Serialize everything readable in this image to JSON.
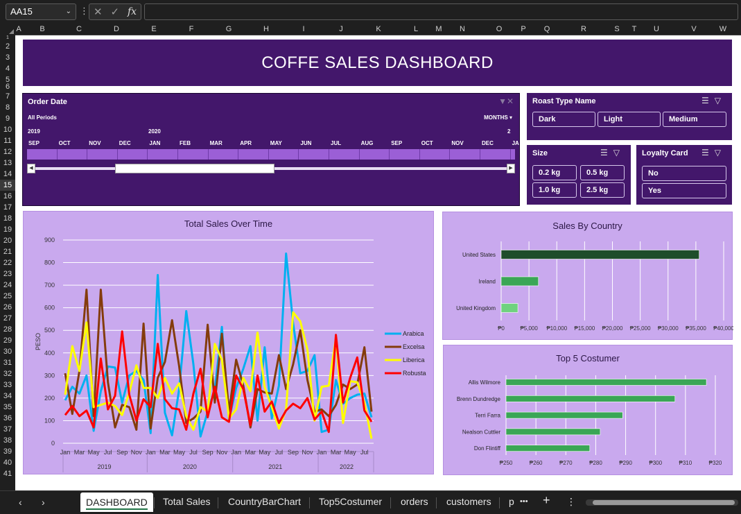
{
  "formula_bar": {
    "name_box": "AA15",
    "formula": "",
    "fx_label": "fx",
    "x_icon": "✕",
    "check_icon": "✓",
    "dots_icon": "⋮"
  },
  "columns": [
    "A",
    "B",
    "C",
    "D",
    "E",
    "F",
    "G",
    "H",
    "I",
    "J",
    "K",
    "L",
    "M",
    "N",
    "O",
    "P",
    "Q",
    "R",
    "S",
    "T",
    "U",
    "V",
    "W"
  ],
  "rows": [
    "1",
    "2",
    "3",
    "4",
    "5",
    "6",
    "7",
    "8",
    "9",
    "10",
    "11",
    "12",
    "13",
    "14",
    "15",
    "16",
    "17",
    "18",
    "19",
    "20",
    "21",
    "22",
    "23",
    "24",
    "25",
    "26",
    "27",
    "28",
    "29",
    "30",
    "31",
    "32",
    "33",
    "34",
    "35",
    "36",
    "37",
    "38",
    "39",
    "40",
    "41"
  ],
  "active_row": "15",
  "dashboard": {
    "title": "COFFE SALES DASHBOARD",
    "timeline": {
      "title": "Order  Date",
      "period": "All Periods",
      "level": "MONTHS",
      "years": [
        "2019",
        "2020",
        "2"
      ],
      "months": [
        "SEP",
        "OCT",
        "NOV",
        "DEC",
        "JAN",
        "FEB",
        "MAR",
        "APR",
        "MAY",
        "JUN",
        "JUL",
        "AUG",
        "SEP",
        "OCT",
        "NOV",
        "DEC",
        "JA"
      ]
    },
    "slicers": {
      "roast": {
        "title": "Roast Type Name",
        "items": [
          "Dark",
          "Light",
          "Medium"
        ]
      },
      "size": {
        "title": "Size",
        "items": [
          "0.2 kg",
          "0.5 kg",
          "1.0 kg",
          "2.5 kg"
        ]
      },
      "loyalty": {
        "title": "Loyalty Card",
        "items": [
          "No",
          "Yes"
        ]
      }
    }
  },
  "colors": {
    "banner": "#43176b",
    "panel": "#c9a9ee",
    "arabica": "#00b0f0",
    "excelsa": "#843c0c",
    "liberica": "#ffff00",
    "robusta": "#ff0000",
    "bar_us": "#1e4d2b",
    "bar_green": "#3aa655",
    "bar_uk": "#6fd27f"
  },
  "chart_data": [
    {
      "type": "line",
      "title": "Total Sales Over Time",
      "ylabel": "PESO",
      "ylim": [
        0,
        900
      ],
      "y_ticks": [
        "0",
        "100",
        "200",
        "300",
        "400",
        "500",
        "600",
        "700",
        "800",
        "900"
      ],
      "month_ticks": [
        "Jan",
        "Mar",
        "May",
        "Jul",
        "Sep",
        "Nov",
        "Jan",
        "Mar",
        "May",
        "Jul",
        "Sep",
        "Nov",
        "Jan",
        "Mar",
        "May",
        "Jul",
        "Sep",
        "Nov",
        "Jan",
        "Mar",
        "May",
        "Jul"
      ],
      "years": [
        "2019",
        "2020",
        "2021",
        "2022"
      ],
      "x": [
        "2019-01",
        "2019-02",
        "2019-03",
        "2019-04",
        "2019-05",
        "2019-06",
        "2019-07",
        "2019-08",
        "2019-09",
        "2019-10",
        "2019-11",
        "2019-12",
        "2020-01",
        "2020-02",
        "2020-03",
        "2020-04",
        "2020-05",
        "2020-06",
        "2020-07",
        "2020-08",
        "2020-09",
        "2020-10",
        "2020-11",
        "2020-12",
        "2021-01",
        "2021-02",
        "2021-03",
        "2021-04",
        "2021-05",
        "2021-06",
        "2021-07",
        "2021-08",
        "2021-09",
        "2021-10",
        "2021-11",
        "2021-12",
        "2022-01",
        "2022-02",
        "2022-03",
        "2022-04",
        "2022-05",
        "2022-06",
        "2022-07",
        "2022-08"
      ],
      "series": [
        {
          "name": "Arabica",
          "values": [
            190,
            250,
            220,
            300,
            55,
            230,
            340,
            335,
            180,
            300,
            320,
            280,
            45,
            745,
            135,
            35,
            240,
            585,
            350,
            30,
            140,
            240,
            515,
            105,
            245,
            330,
            430,
            100,
            425,
            110,
            255,
            840,
            530,
            310,
            320,
            390,
            50,
            60,
            280,
            175,
            200,
            215,
            220,
            115
          ]
        },
        {
          "name": "Excelsa",
          "values": [
            310,
            130,
            320,
            680,
            120,
            680,
            270,
            70,
            170,
            160,
            60,
            530,
            65,
            290,
            360,
            545,
            340,
            90,
            110,
            140,
            525,
            180,
            485,
            140,
            370,
            255,
            70,
            240,
            225,
            220,
            390,
            240,
            350,
            500,
            280,
            140,
            150,
            120,
            170,
            260,
            240,
            260,
            425,
            140
          ]
        },
        {
          "name": "Liberica",
          "values": [
            215,
            430,
            320,
            535,
            160,
            170,
            180,
            165,
            125,
            225,
            345,
            245,
            245,
            200,
            290,
            220,
            265,
            120,
            60,
            160,
            140,
            440,
            370,
            110,
            150,
            290,
            230,
            490,
            250,
            160,
            65,
            150,
            580,
            540,
            415,
            100,
            250,
            255,
            465,
            90,
            275,
            270,
            180,
            20
          ]
        },
        {
          "name": "Robusta",
          "values": [
            125,
            165,
            120,
            145,
            70,
            375,
            150,
            210,
            495,
            215,
            100,
            195,
            160,
            440,
            195,
            155,
            150,
            60,
            220,
            330,
            115,
            250,
            115,
            95,
            300,
            240,
            80,
            300,
            140,
            185,
            90,
            145,
            175,
            155,
            200,
            105,
            140,
            50,
            480,
            180,
            290,
            380,
            145,
            95
          ]
        }
      ]
    },
    {
      "type": "bar",
      "title": "Sales By Country",
      "categories": [
        "United States",
        "Ireland",
        "United Kingdom"
      ],
      "values": [
        35600,
        6700,
        3000
      ],
      "xlim": [
        0,
        40000
      ],
      "x_ticks": [
        "₱0",
        "₱5,000",
        "₱10,000",
        "₱15,000",
        "₱20,000",
        "₱25,000",
        "₱30,000",
        "₱35,000",
        "₱40,000"
      ]
    },
    {
      "type": "bar",
      "title": "Top 5 Costumer",
      "categories": [
        "Allis Wilmore",
        "Brenn Dundredge",
        "Terri Farra",
        "Nealson Cuttler",
        "Don Flintiff"
      ],
      "values": [
        317,
        306.5,
        289,
        281.5,
        278
      ],
      "xlim": [
        250,
        320
      ],
      "x_ticks": [
        "₱250",
        "₱260",
        "₱270",
        "₱280",
        "₱290",
        "₱300",
        "₱310",
        "₱320"
      ]
    }
  ],
  "tabs": {
    "items": [
      "DASHBOARD",
      "Total Sales",
      "CountryBarChart",
      "Top5Costumer",
      "orders",
      "customers",
      "p"
    ],
    "active": "DASHBOARD",
    "more": "•••",
    "add": "+",
    "menu": "⋮",
    "prev": "‹",
    "next": "›"
  }
}
